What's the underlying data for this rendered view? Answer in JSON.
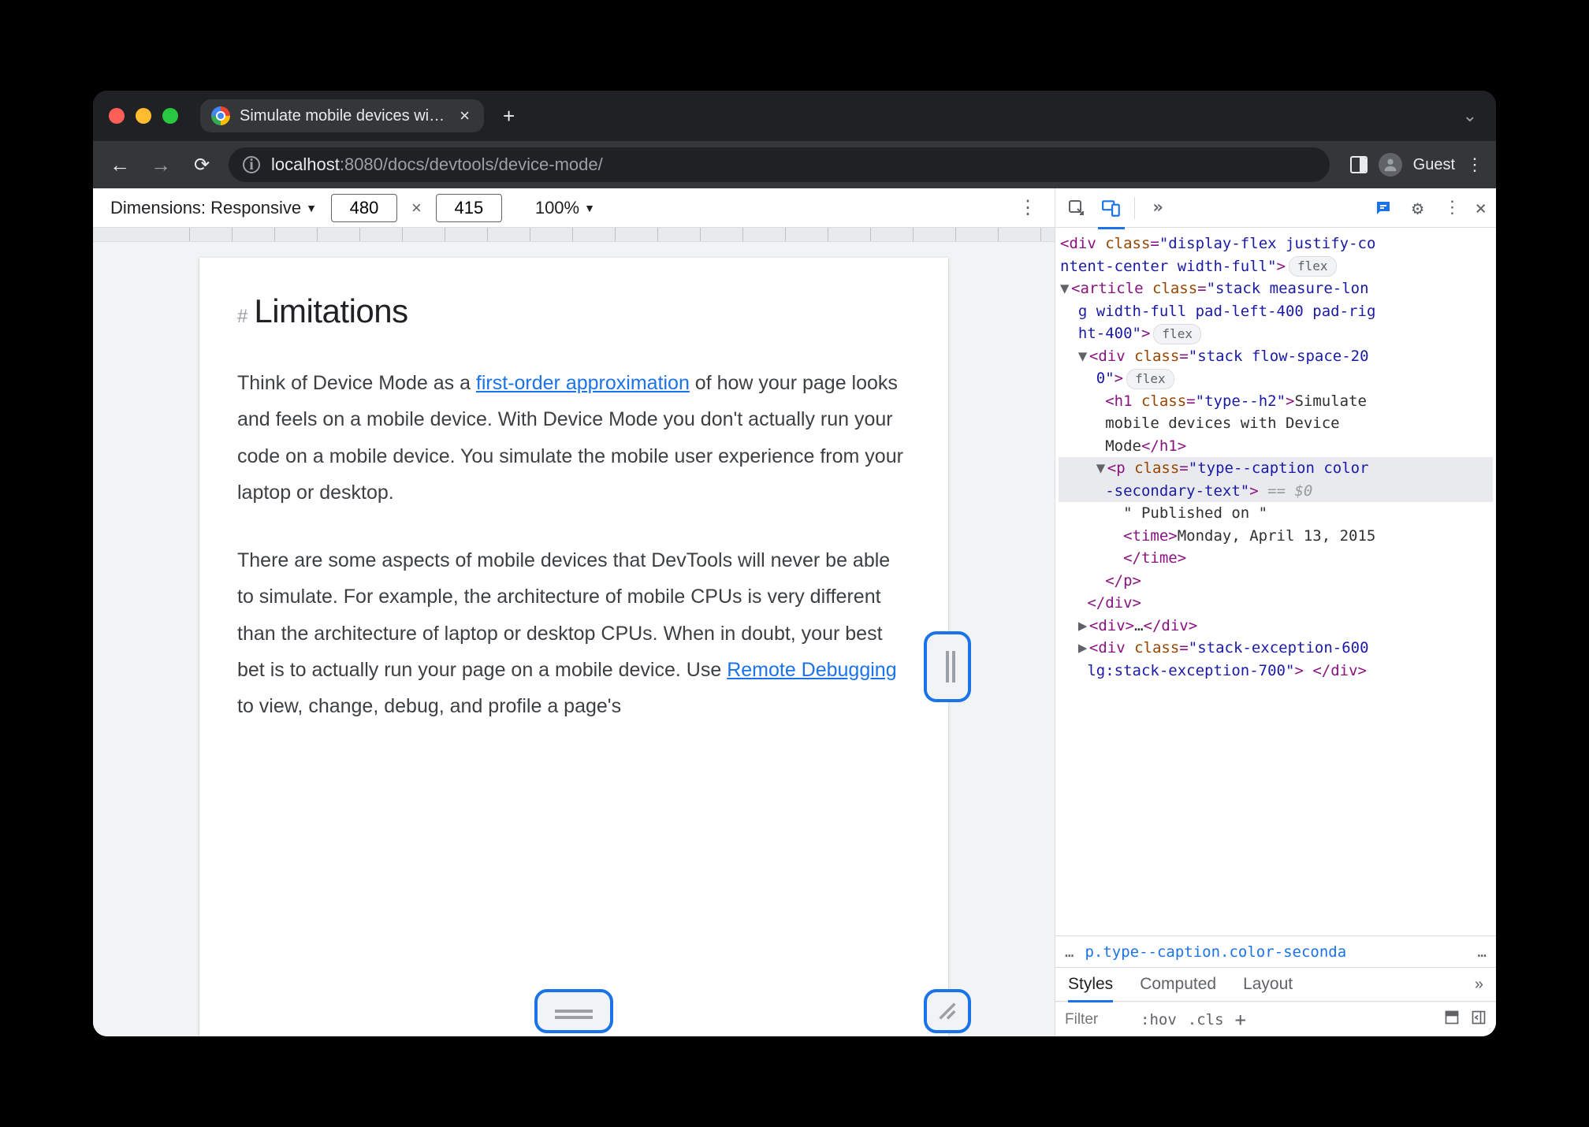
{
  "titlebar": {
    "tab_title": "Simulate mobile devices with D",
    "close_glyph": "×",
    "new_tab_glyph": "+",
    "chevron_glyph": "⌄"
  },
  "toolbar": {
    "back_glyph": "←",
    "forward_glyph": "→",
    "reload_glyph": "⟳",
    "info_glyph": "i",
    "url_host": "localhost",
    "url_port": ":8080",
    "url_path": "/docs/devtools/device-mode/",
    "guest_label": "Guest",
    "kebab_glyph": "⋮"
  },
  "device_toolbar": {
    "dimensions_label": "Dimensions: Responsive",
    "dim_caret": "▼",
    "width": "480",
    "x_glyph": "×",
    "height": "415",
    "zoom_label": "100%",
    "zoom_caret": "▼",
    "kebab_glyph": "⋮"
  },
  "page": {
    "hash": "#",
    "heading": "Limitations",
    "p1_a": "Think of Device Mode as a ",
    "p1_link": "first-order approximation",
    "p1_b": " of how your page looks and feels on a mobile device. With Device Mode you don't actually run your code on a mobile device. You simulate the mobile user experience from your laptop or desktop.",
    "p2_a": "There are some aspects of mobile devices that DevTools will never be able to simulate. For example, the architecture of mobile CPUs is very different than the architecture of laptop or desktop CPUs. When in doubt, your best bet is to actually run your page on a mobile device. Use ",
    "p2_link": "Remote Debugging",
    "p2_b": " to view, change, debug, and profile a page's"
  },
  "devtools": {
    "more_glyph": "»",
    "gear_glyph": "⚙",
    "kebab_glyph": "⋮",
    "close_glyph": "×",
    "flex_pill": "flex",
    "tree": {
      "l1a": "<div",
      "l1b": " class",
      "l1c": "=",
      "l1d": "\"display-flex justify-co",
      "l2": "ntent-center width-full\"",
      "l2b": ">",
      "l3_arrow": "▼",
      "l3a": "<article",
      "l3b": " class",
      "l3c": "=",
      "l3d": "\"stack measure-lon",
      "l4": "g width-full pad-left-400 pad-rig",
      "l5": "ht-400\"",
      "l5b": ">",
      "l6_arrow": "▼",
      "l6a": "<div",
      "l6b": " class",
      "l6c": "=",
      "l6d": "\"stack flow-space-20",
      "l7": "0\"",
      "l7b": ">",
      "l8a": "<h1",
      "l8b": " class",
      "l8c": "=",
      "l8d": "\"type--h2\"",
      "l8e": ">",
      "l8f": "Simulate",
      "l9": "mobile devices with Device",
      "l10a": "Mode",
      "l10b": "</h1>",
      "l11_arrow": "▼",
      "l11a": "<p",
      "l11b": " class",
      "l11c": "=",
      "l11d": "\"type--caption color",
      "l12": "-secondary-text\"",
      "l12b": ">",
      "l12c": " == ",
      "l12d": "$0",
      "l13": "\" Published on \"",
      "l14a": "<time>",
      "l14b": "Monday, April 13, 2015",
      "l15": "</time>",
      "l16": "</p>",
      "l17": "</div>",
      "l18_arrow": "▶",
      "l18a": "<div>",
      "l18b": "…",
      "l18c": "</div>",
      "l19_arrow": "▶",
      "l19a": "<div",
      "l19b": " class",
      "l19c": "=",
      "l19d": "\"stack-exception-600",
      "l20": "lg:stack-exception-700\"",
      "l20b": "> ",
      "l20c": "</div>"
    },
    "breadcrumb": {
      "dots": "…",
      "selector": "p.type--caption.color-seconda",
      "dots2": "…"
    },
    "styles_tabs": {
      "styles": "Styles",
      "computed": "Computed",
      "layout": "Layout",
      "more": "»"
    },
    "filter": {
      "placeholder": "Filter",
      "hov": ":hov",
      "cls": ".cls",
      "plus": "+"
    }
  }
}
